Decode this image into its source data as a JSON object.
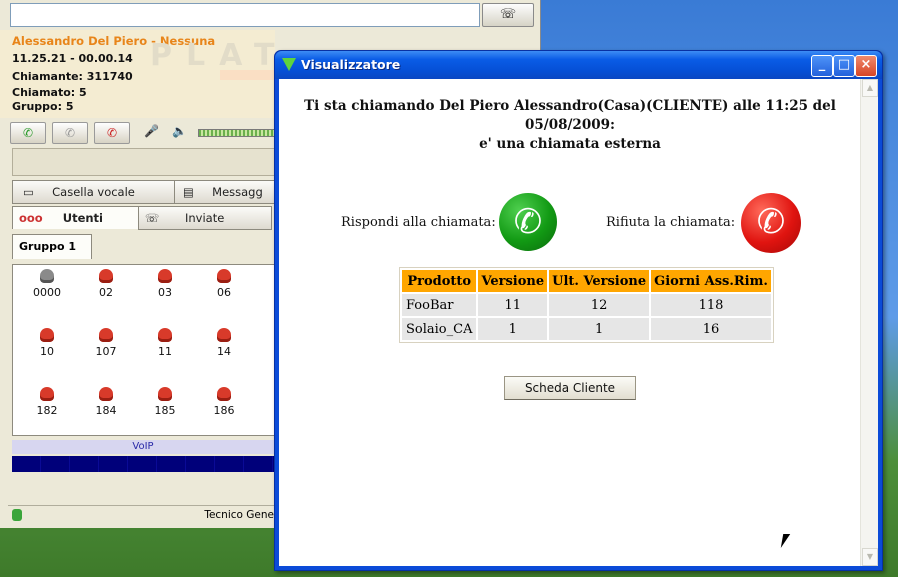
{
  "background_app": {
    "caller_name": "Alessandro Del Piero - Nessuna",
    "time_line": "11.25.21 - 00.00.14",
    "caller_line": "Chiamante: 311740",
    "called_line": "Chiamato: 5",
    "group_line": "Gruppo: 5",
    "watermark": "PLAT",
    "tabs": {
      "voicemail": "Casella vocale",
      "messages": "Messagg",
      "users": "Utenti",
      "sent": "Inviate"
    },
    "group_tab": "Gruppo 1",
    "users": [
      "0000",
      "02",
      "03",
      "06",
      "10",
      "107",
      "11",
      "14",
      "182",
      "184",
      "185",
      "186"
    ],
    "voip_label": "VoIP",
    "status_text": "Tecnico Gene"
  },
  "window": {
    "title": "Visualizzatore",
    "minimize_glyph": "_",
    "maximize_glyph": "□",
    "close_glyph": "×",
    "message_line1": "Ti sta chiamando Del Piero Alessandro(Casa)(CLIENTE) alle 11:25 del 05/08/2009:",
    "message_line2": "e' una chiamata esterna",
    "answer_label": "Rispondi alla chiamata:",
    "reject_label": "Rifiuta la chiamata:",
    "table": {
      "headers": [
        "Prodotto",
        "Versione",
        "Ult. Versione",
        "Giorni Ass.Rim."
      ],
      "rows": [
        [
          "FooBar",
          "11",
          "12",
          "118"
        ],
        [
          "Solaio_CA",
          "1",
          "1",
          "16"
        ]
      ]
    },
    "customer_button": "Scheda Cliente"
  },
  "colors": {
    "title_bar": "#0a5ce6",
    "table_header": "#ffa600",
    "answer_green": "#129a14",
    "reject_red": "#e01410",
    "caller_name": "#e8851a"
  },
  "icons": {
    "answer": "phone-green-icon",
    "reject": "phone-red-icon",
    "user": "user-phone-icon"
  }
}
